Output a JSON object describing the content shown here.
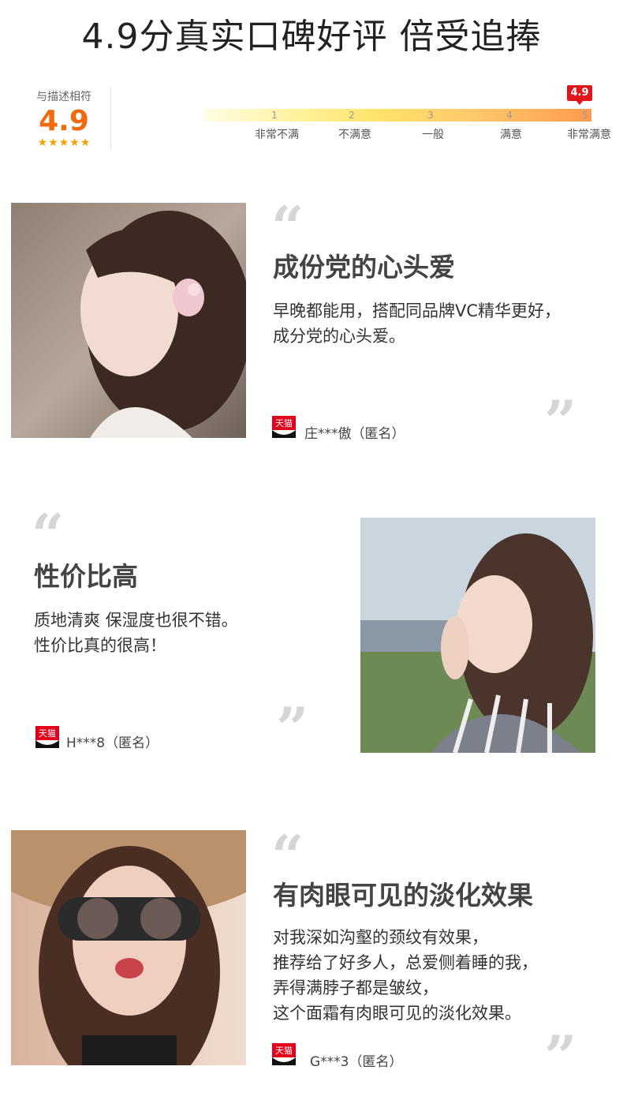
{
  "headline": "4.9分真实口碑好评 倍受追捧",
  "rating": {
    "label": "与描述相符",
    "score": "4.9",
    "stars": 5,
    "flag": "4.9",
    "scale": [
      {
        "num": "1",
        "label": "非常不满"
      },
      {
        "num": "2",
        "label": "不满意"
      },
      {
        "num": "3",
        "label": "一般"
      },
      {
        "num": "4",
        "label": "满意"
      },
      {
        "num": "5",
        "label": "非常满意"
      }
    ]
  },
  "reviews": [
    {
      "title": "成份党的心头爱",
      "body": [
        "早晚都能用，搭配同品牌VC精华更好，",
        "成分党的心头爱。"
      ],
      "user": "庄***傲（匿名）",
      "badge": "天猫"
    },
    {
      "title": "性价比高",
      "body": [
        "质地清爽 保湿度也很不错。",
        "性价比真的很高！"
      ],
      "user": "H***8（匿名）",
      "badge": "天猫"
    },
    {
      "title": "有肉眼可见的淡化效果",
      "body": [
        "对我深如沟壑的颈纹有效果，",
        "推荐给了好多人，总爱侧着睡的我，",
        "弄得满脖子都是皱纹，",
        "这个面霜有肉眼可见的淡化效果。"
      ],
      "user": "G***3（匿名）",
      "badge": "天猫"
    }
  ],
  "quote_marks": {
    "open": "“",
    "close": "”"
  }
}
